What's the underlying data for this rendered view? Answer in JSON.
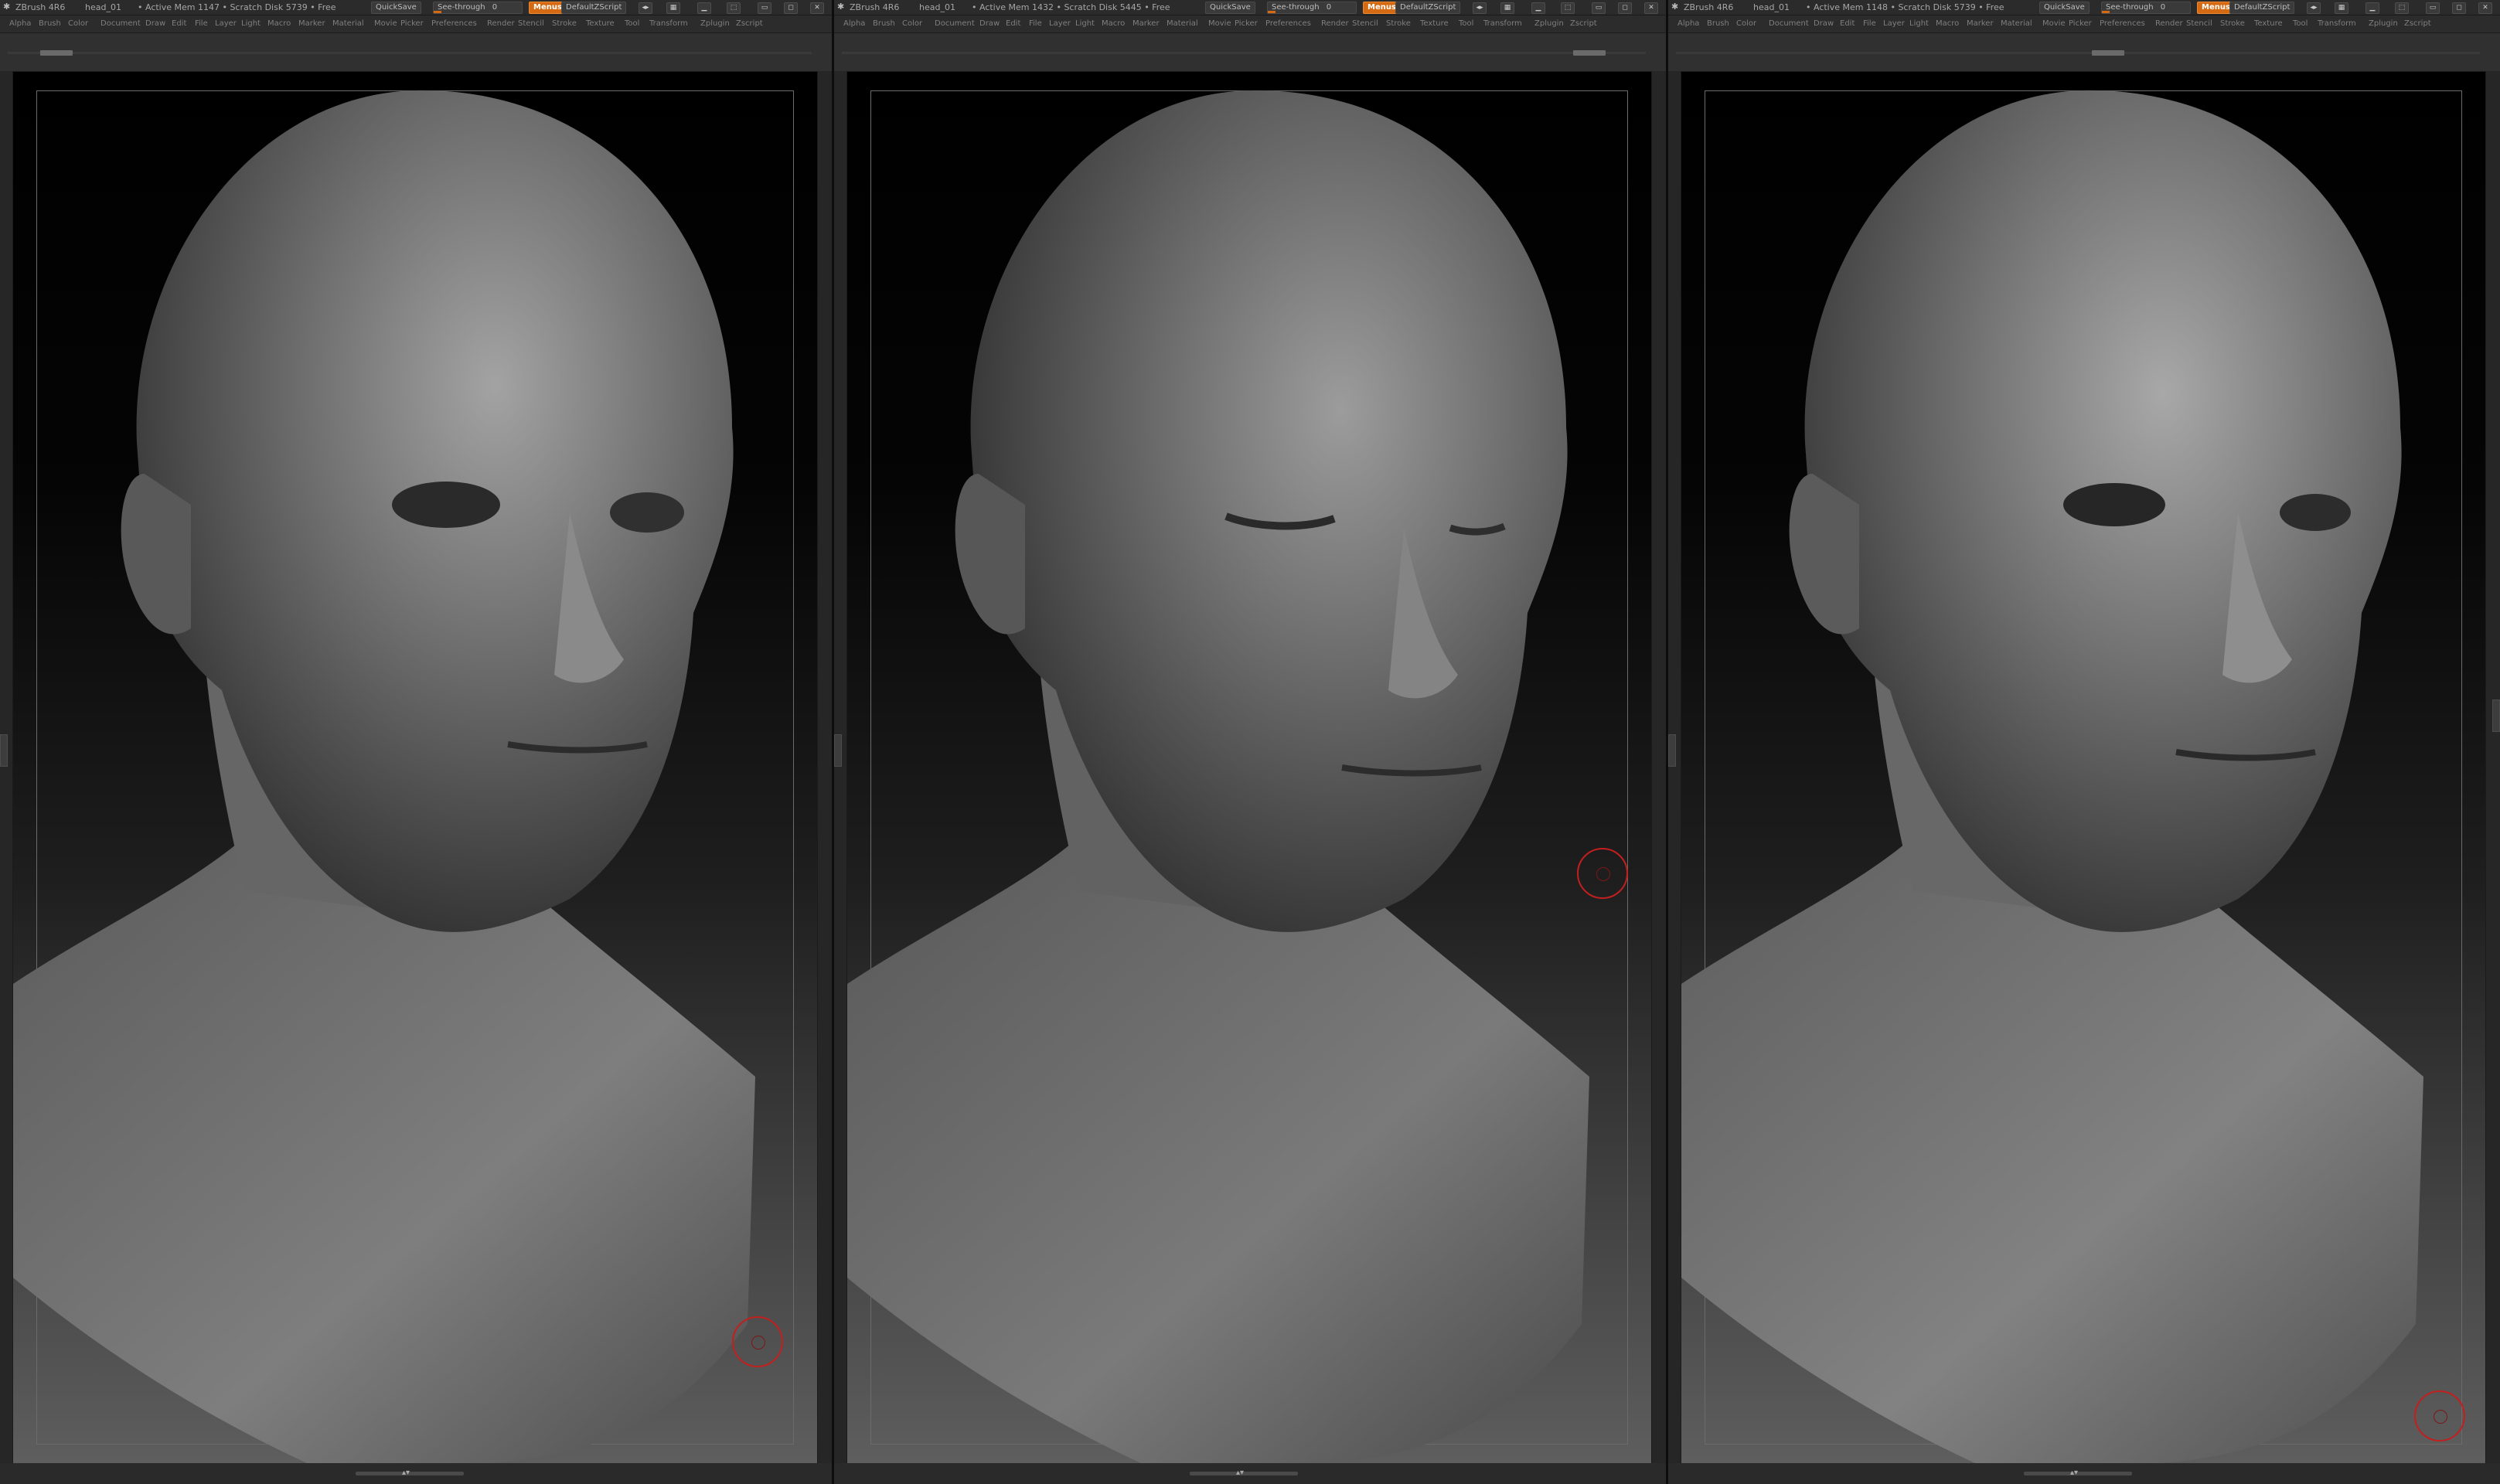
{
  "menu_labels": [
    "Alpha",
    "Brush",
    "Color",
    "Document",
    "Draw",
    "Edit",
    "File",
    "Layer",
    "Light",
    "Macro",
    "Marker",
    "Material",
    "Movie",
    "Picker",
    "Preferences",
    "Render",
    "Stencil",
    "Stroke",
    "Texture",
    "Tool",
    "Transform",
    "Zplugin",
    "Zscript"
  ],
  "panels": [
    {
      "title": {
        "app": "ZBrush 4R6",
        "doc": "head_01",
        "active_mem": "• Active Mem 1147 • Scratch Disk 5739 • Free",
        "quicksave": "QuickSave",
        "see_through": "See-through",
        "see_through_value": "0",
        "menus": "Menus",
        "script": "DefaultZScript"
      }
    },
    {
      "title": {
        "app": "ZBrush 4R6",
        "doc": "head_01",
        "active_mem": "• Active Mem 1432 • Scratch Disk 5445 • Free",
        "quicksave": "QuickSave",
        "see_through": "See-through",
        "see_through_value": "0",
        "menus": "Menus",
        "script": "DefaultZScript"
      }
    },
    {
      "title": {
        "app": "ZBrush 4R6",
        "doc": "head_01",
        "active_mem": "• Active Mem 1148 • Scratch Disk 5739 • Free",
        "quicksave": "QuickSave",
        "see_through": "See-through",
        "see_through_value": "0",
        "menus": "Menus",
        "script": "DefaultZScript"
      }
    }
  ],
  "icons": [
    "zbrush-logo-icon",
    "arrow-icon",
    "layout-icon",
    "minimize-icon",
    "restore-icon",
    "close-icon",
    "lock-icon"
  ]
}
